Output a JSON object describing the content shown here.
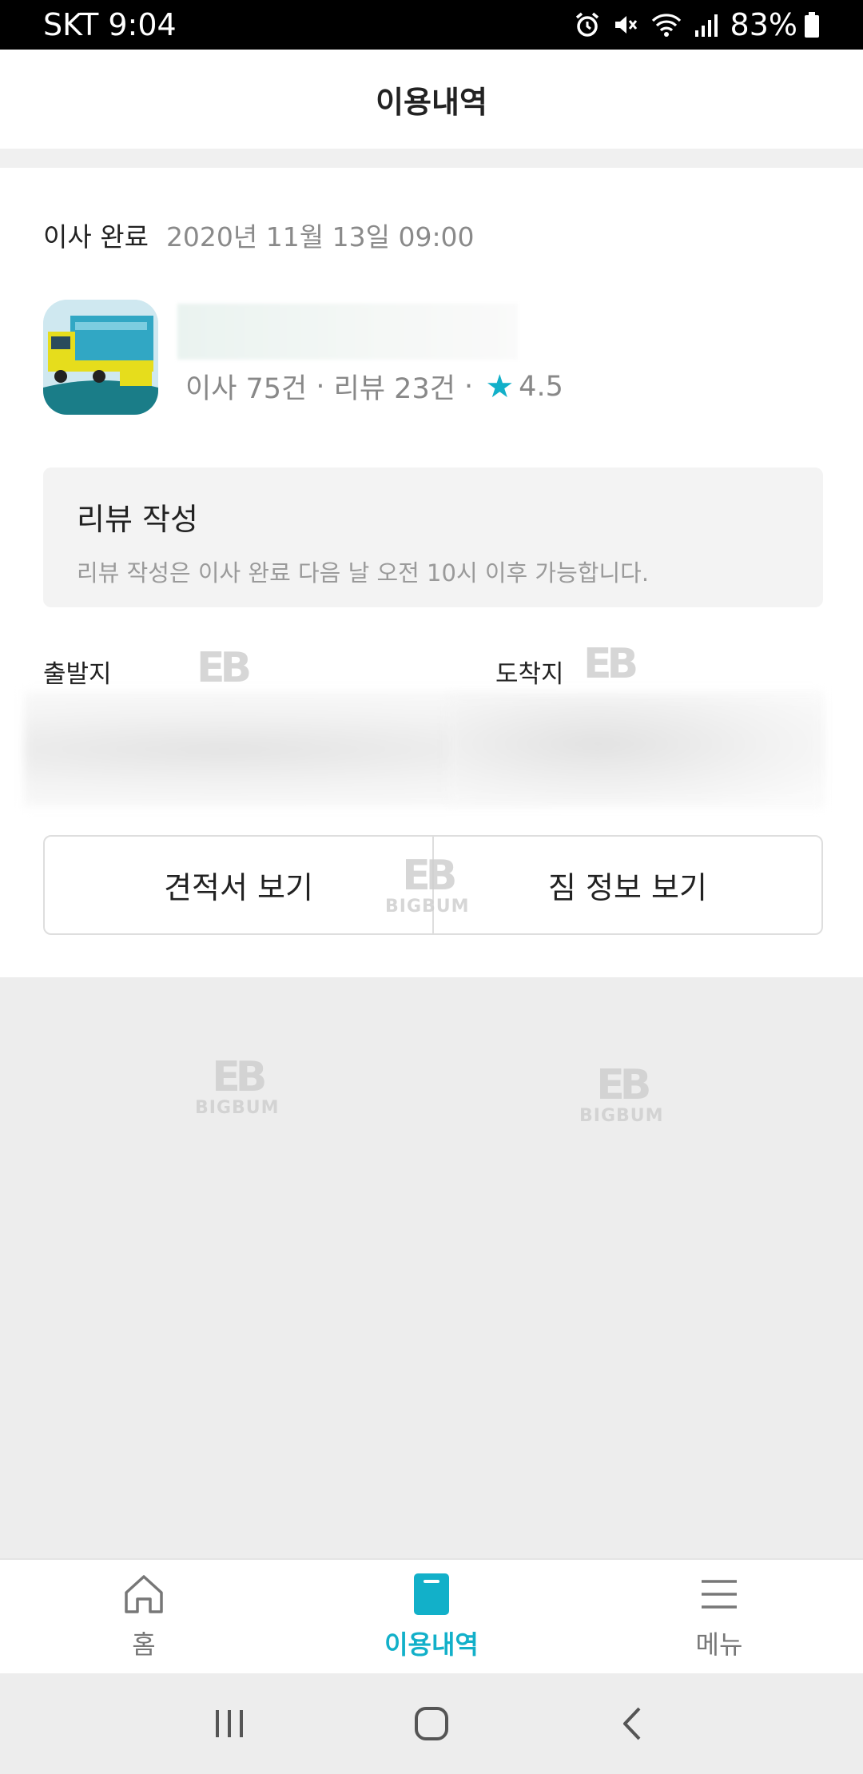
{
  "status_bar": {
    "carrier_time": "SKT 9:04",
    "battery": "83%"
  },
  "header": {
    "title": "이용내역"
  },
  "history": {
    "state": "이사 완료",
    "datetime": "2020년 11월 13일 09:00",
    "company": {
      "moves": "이사 75건",
      "reviews": "리뷰 23건",
      "rating": "4.5"
    },
    "review": {
      "title": "리뷰 작성",
      "desc": "리뷰 작성은 이사 완료 다음 날 오전 10시 이후 가능합니다."
    },
    "origin_label": "출발지",
    "destination_label": "도착지",
    "buttons": {
      "estimate": "견적서 보기",
      "cargo": "짐 정보 보기"
    }
  },
  "watermark": {
    "mark": "EB",
    "text": "BIGBUM"
  },
  "bottom_nav": {
    "home": "홈",
    "history": "이용내역",
    "menu": "메뉴"
  },
  "colors": {
    "accent": "#12b0c9"
  }
}
